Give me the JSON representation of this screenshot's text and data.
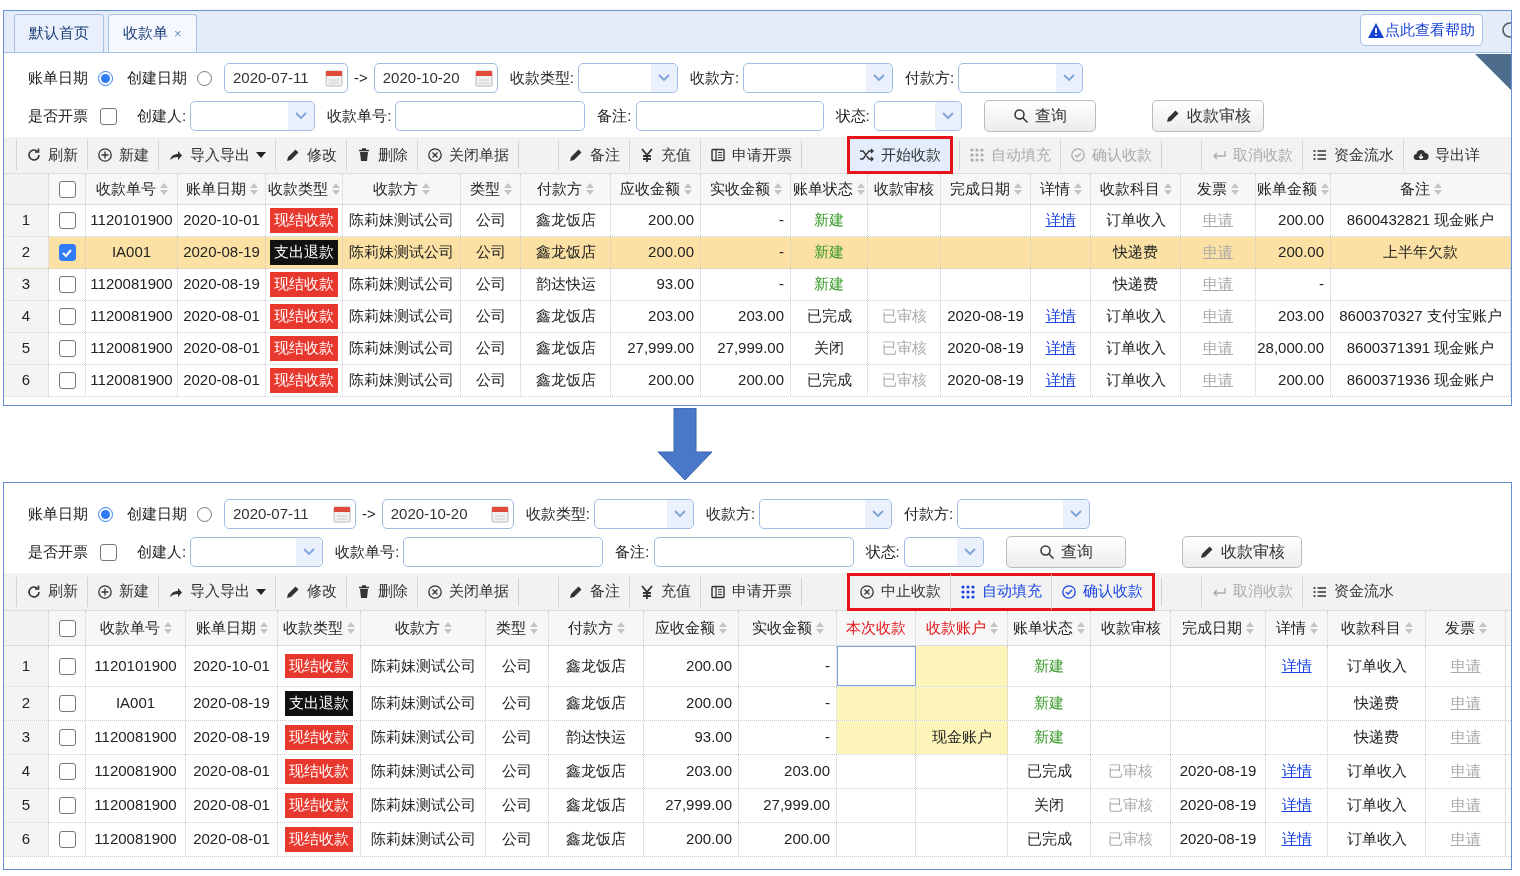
{
  "before": {
    "tab_bar": {
      "tabs": [
        {
          "label": "默认首页",
          "selected": false
        },
        {
          "label": "收款单",
          "selected": true,
          "close": "×"
        }
      ],
      "help": "点此查看帮助"
    },
    "filters": {
      "date_modes": [
        {
          "label": "账单日期",
          "selected": true
        },
        {
          "label": "创建日期",
          "selected": false
        }
      ],
      "date_from": "2020-07-11",
      "range_sep": "->",
      "date_to": "2020-10-20",
      "fields_row1": [
        {
          "label": "收款类型:",
          "kind": "select"
        },
        {
          "label": "收款方:",
          "kind": "select"
        },
        {
          "label": "付款方:",
          "kind": "select"
        }
      ],
      "invoice_filter": {
        "label": "是否开票",
        "checked": false
      },
      "fields_row2": [
        {
          "label": "创建人:",
          "kind": "select"
        },
        {
          "label": "收款单号:",
          "kind": "input"
        },
        {
          "label": "备注:",
          "kind": "input"
        },
        {
          "label": "状态:",
          "kind": "select"
        }
      ],
      "buttons": [
        {
          "label": "查询",
          "kind": "search"
        },
        {
          "label": "收款审核",
          "kind": "pencil"
        }
      ]
    },
    "toolbar": [
      [
        {
          "label": "刷新",
          "kind": "refresh",
          "disabled": false,
          "pressed": false,
          "highlighted": false,
          "callout": false
        },
        {
          "label": "新建",
          "kind": "plus",
          "disabled": false,
          "pressed": false,
          "highlighted": false,
          "callout": false
        },
        {
          "label": "导入导出",
          "kind": "share",
          "disabled": false,
          "pressed": false,
          "highlighted": false,
          "callout": false,
          "dropdown": true
        },
        {
          "label": "修改",
          "kind": "pencil",
          "disabled": false,
          "pressed": false,
          "highlighted": false,
          "callout": false
        },
        {
          "label": "删除",
          "kind": "trash",
          "disabled": false,
          "pressed": false,
          "highlighted": false,
          "callout": false
        },
        {
          "label": "关闭单据",
          "kind": "xcircle",
          "disabled": false,
          "pressed": false,
          "highlighted": false,
          "callout": false
        }
      ],
      [
        {
          "label": "备注",
          "kind": "pencil",
          "disabled": false,
          "pressed": false,
          "highlighted": false,
          "callout": false
        },
        {
          "label": "充值",
          "kind": "yen",
          "disabled": false,
          "pressed": false,
          "highlighted": false,
          "callout": false
        },
        {
          "label": "申请开票",
          "kind": "book",
          "disabled": false,
          "pressed": false,
          "highlighted": false,
          "callout": false
        }
      ],
      [
        {
          "label": "开始收款",
          "kind": "shuffle",
          "disabled": false,
          "pressed": true,
          "highlighted": false,
          "callout": true
        },
        {
          "label": "自动填充",
          "kind": "grid",
          "disabled": true,
          "pressed": false,
          "highlighted": false,
          "callout": false
        },
        {
          "label": "确认收款",
          "kind": "check",
          "disabled": true,
          "pressed": false,
          "highlighted": false,
          "callout": false
        }
      ],
      [
        {
          "label": "取消收款",
          "kind": "return",
          "disabled": true,
          "pressed": false,
          "highlighted": false,
          "callout": false
        },
        {
          "label": "资金流水",
          "kind": "list",
          "disabled": false,
          "pressed": false,
          "highlighted": false,
          "callout": false
        },
        {
          "label": "导出详",
          "kind": "cloud",
          "disabled": false,
          "pressed": false,
          "highlighted": false,
          "callout": false
        }
      ]
    ],
    "table": {
      "select_all_checked": false,
      "columns": [
        {
          "label": "收款单号",
          "kind": "text",
          "sortable": true,
          "emphasis": false
        },
        {
          "label": "账单日期",
          "kind": "text",
          "sortable": true,
          "emphasis": false
        },
        {
          "label": "收款类型",
          "kind": "tag",
          "sortable": true,
          "emphasis": false
        },
        {
          "label": "收款方",
          "kind": "text",
          "sortable": true,
          "emphasis": false
        },
        {
          "label": "类型",
          "kind": "text",
          "sortable": true,
          "emphasis": false
        },
        {
          "label": "付款方",
          "kind": "text",
          "sortable": true,
          "emphasis": false
        },
        {
          "label": "应收金额",
          "kind": "amount",
          "sortable": true,
          "emphasis": false
        },
        {
          "label": "实收金额",
          "kind": "amount",
          "sortable": true,
          "emphasis": false
        },
        {
          "label": "账单状态",
          "kind": "status",
          "sortable": true,
          "emphasis": false
        },
        {
          "label": "收款审核",
          "kind": "muted",
          "sortable": false,
          "emphasis": false
        },
        {
          "label": "完成日期",
          "kind": "text",
          "sortable": true,
          "emphasis": false
        },
        {
          "label": "详情",
          "kind": "link",
          "sortable": true,
          "emphasis": false
        },
        {
          "label": "收款科目",
          "kind": "text",
          "sortable": true,
          "emphasis": false
        },
        {
          "label": "发票",
          "kind": "invoice",
          "sortable": true,
          "emphasis": false
        },
        {
          "label": "账单金额",
          "kind": "amount",
          "sortable": true,
          "emphasis": false
        },
        {
          "label": "备注",
          "kind": "text",
          "sortable": true,
          "emphasis": false
        }
      ],
      "rows": [
        {
          "number": "1",
          "checked": false,
          "selected": false,
          "cells": [
            "1120101900",
            "2020-10-01",
            {
              "text": "现结收款",
              "color": "#e8372c"
            },
            "陈莉妹测试公司",
            "公司",
            "鑫龙饭店",
            "200.00",
            "-",
            {
              "text": "新建",
              "color": "#3a9a2a"
            },
            null,
            null,
            "详情",
            "订单收入",
            "申请",
            "200.00",
            "8600432821 现金账户"
          ]
        },
        {
          "number": "2",
          "checked": true,
          "selected": true,
          "cells": [
            "IA001",
            "2020-08-19",
            {
              "text": "支出退款",
              "color": "#111111"
            },
            "陈莉妹测试公司",
            "公司",
            "鑫龙饭店",
            "200.00",
            "-",
            {
              "text": "新建",
              "color": "#3a9a2a"
            },
            null,
            null,
            null,
            "快递费",
            "申请",
            "200.00",
            "上半年欠款"
          ]
        },
        {
          "number": "3",
          "checked": false,
          "selected": false,
          "cells": [
            "1120081900",
            "2020-08-19",
            {
              "text": "现结收款",
              "color": "#e8372c"
            },
            "陈莉妹测试公司",
            "公司",
            "韵达快运",
            "93.00",
            "-",
            {
              "text": "新建",
              "color": "#3a9a2a"
            },
            null,
            null,
            null,
            "快递费",
            "申请",
            "-",
            null
          ]
        },
        {
          "number": "4",
          "checked": false,
          "selected": false,
          "cells": [
            "1120081900",
            "2020-08-01",
            {
              "text": "现结收款",
              "color": "#e8372c"
            },
            "陈莉妹测试公司",
            "公司",
            "鑫龙饭店",
            "203.00",
            "203.00",
            {
              "text": "已完成",
              "color": "#222222"
            },
            "已审核",
            "2020-08-19",
            "详情",
            "订单收入",
            "申请",
            "203.00",
            "8600370327 支付宝账户"
          ]
        },
        {
          "number": "5",
          "checked": false,
          "selected": false,
          "cells": [
            "1120081900",
            "2020-08-01",
            {
              "text": "现结收款",
              "color": "#e8372c"
            },
            "陈莉妹测试公司",
            "公司",
            "鑫龙饭店",
            "27,999.00",
            "27,999.00",
            {
              "text": "关闭",
              "color": "#222222"
            },
            "已审核",
            "2020-08-19",
            "详情",
            "订单收入",
            "申请",
            "28,000.00",
            "8600371391 现金账户"
          ]
        },
        {
          "number": "6",
          "checked": false,
          "selected": false,
          "cells": [
            "1120081900",
            "2020-08-01",
            {
              "text": "现结收款",
              "color": "#e8372c"
            },
            "陈莉妹测试公司",
            "公司",
            "鑫龙饭店",
            "200.00",
            "200.00",
            {
              "text": "已完成",
              "color": "#222222"
            },
            "已审核",
            "2020-08-19",
            "详情",
            "订单收入",
            "申请",
            "200.00",
            "8600371936 现金账户"
          ]
        }
      ]
    }
  },
  "after": {
    "filters": {
      "date_modes": [
        {
          "label": "账单日期",
          "selected": true
        },
        {
          "label": "创建日期",
          "selected": false
        }
      ],
      "date_from": "2020-07-11",
      "range_sep": "->",
      "date_to": "2020-10-20",
      "fields_row1": [
        {
          "label": "收款类型:",
          "kind": "select"
        },
        {
          "label": "收款方:",
          "kind": "select"
        },
        {
          "label": "付款方:",
          "kind": "select"
        }
      ],
      "invoice_filter": {
        "label": "是否开票",
        "checked": false
      },
      "fields_row2": [
        {
          "label": "创建人:",
          "kind": "select"
        },
        {
          "label": "收款单号:",
          "kind": "input"
        },
        {
          "label": "备注:",
          "kind": "input"
        },
        {
          "label": "状态:",
          "kind": "select"
        }
      ],
      "buttons": [
        {
          "label": "查询",
          "kind": "search"
        },
        {
          "label": "收款审核",
          "kind": "pencil"
        }
      ]
    },
    "toolbar": [
      [
        {
          "label": "刷新",
          "kind": "refresh",
          "disabled": false,
          "pressed": false,
          "highlighted": false,
          "callout": false
        },
        {
          "label": "新建",
          "kind": "plus",
          "disabled": false,
          "pressed": false,
          "highlighted": false,
          "callout": false
        },
        {
          "label": "导入导出",
          "kind": "share",
          "disabled": false,
          "pressed": false,
          "highlighted": false,
          "callout": false,
          "dropdown": true
        },
        {
          "label": "修改",
          "kind": "pencil",
          "disabled": false,
          "pressed": false,
          "highlighted": false,
          "callout": false
        },
        {
          "label": "删除",
          "kind": "trash",
          "disabled": false,
          "pressed": false,
          "highlighted": false,
          "callout": false
        },
        {
          "label": "关闭单据",
          "kind": "xcircle",
          "disabled": false,
          "pressed": false,
          "highlighted": false,
          "callout": false
        }
      ],
      [
        {
          "label": "备注",
          "kind": "pencil",
          "disabled": false,
          "pressed": false,
          "highlighted": false,
          "callout": false
        },
        {
          "label": "充值",
          "kind": "yen",
          "disabled": false,
          "pressed": false,
          "highlighted": false,
          "callout": false
        },
        {
          "label": "申请开票",
          "kind": "book",
          "disabled": false,
          "pressed": false,
          "highlighted": false,
          "callout": false
        }
      ],
      [
        {
          "label": "中止收款",
          "kind": "xcircle",
          "disabled": false,
          "pressed": false,
          "highlighted": false,
          "callout": true
        },
        {
          "label": "自动填充",
          "kind": "grid",
          "disabled": false,
          "pressed": false,
          "highlighted": true,
          "callout": true
        },
        {
          "label": "确认收款",
          "kind": "check",
          "disabled": false,
          "pressed": false,
          "highlighted": true,
          "callout": true
        }
      ],
      [
        {
          "label": "取消收款",
          "kind": "return",
          "disabled": true,
          "pressed": false,
          "highlighted": false,
          "callout": false
        },
        {
          "label": "资金流水",
          "kind": "list",
          "disabled": false,
          "pressed": false,
          "highlighted": false,
          "callout": false
        }
      ]
    ],
    "table": {
      "select_all_checked": false,
      "columns": [
        {
          "label": "收款单号",
          "kind": "text",
          "sortable": true,
          "emphasis": false
        },
        {
          "label": "账单日期",
          "kind": "text",
          "sortable": true,
          "emphasis": false
        },
        {
          "label": "收款类型",
          "kind": "tag",
          "sortable": true,
          "emphasis": false
        },
        {
          "label": "收款方",
          "kind": "text",
          "sortable": true,
          "emphasis": false
        },
        {
          "label": "类型",
          "kind": "text",
          "sortable": true,
          "emphasis": false
        },
        {
          "label": "付款方",
          "kind": "text",
          "sortable": true,
          "emphasis": false
        },
        {
          "label": "应收金额",
          "kind": "amount",
          "sortable": true,
          "emphasis": false
        },
        {
          "label": "实收金额",
          "kind": "amount",
          "sortable": true,
          "emphasis": false
        },
        {
          "label": "本次收款",
          "kind": "entry",
          "sortable": false,
          "emphasis": true
        },
        {
          "label": "收款账户",
          "kind": "entry",
          "sortable": true,
          "emphasis": true
        },
        {
          "label": "账单状态",
          "kind": "status",
          "sortable": true,
          "emphasis": false
        },
        {
          "label": "收款审核",
          "kind": "muted",
          "sortable": false,
          "emphasis": false
        },
        {
          "label": "完成日期",
          "kind": "text",
          "sortable": true,
          "emphasis": false
        },
        {
          "label": "详情",
          "kind": "link",
          "sortable": true,
          "emphasis": false
        },
        {
          "label": "收款科目",
          "kind": "text",
          "sortable": true,
          "emphasis": false
        },
        {
          "label": "发票",
          "kind": "invoice",
          "sortable": true,
          "emphasis": false
        }
      ],
      "rows": [
        {
          "number": "1",
          "checked": false,
          "selected": false,
          "cells": [
            "1120101900",
            "2020-10-01",
            {
              "text": "现结收款",
              "color": "#e8372c"
            },
            "陈莉妹测试公司",
            "公司",
            "鑫龙饭店",
            "200.00",
            "-",
            {
              "editable": true,
              "focused": true
            },
            {
              "editable": true,
              "focused": false
            },
            {
              "text": "新建",
              "color": "#3a9a2a"
            },
            null,
            null,
            "详情",
            "订单收入",
            "申请"
          ]
        },
        {
          "number": "2",
          "checked": false,
          "selected": false,
          "cells": [
            "IA001",
            "2020-08-19",
            {
              "text": "支出退款",
              "color": "#111111"
            },
            "陈莉妹测试公司",
            "公司",
            "鑫龙饭店",
            "200.00",
            "-",
            {
              "editable": true,
              "focused": false
            },
            {
              "editable": true,
              "focused": false
            },
            {
              "text": "新建",
              "color": "#3a9a2a"
            },
            null,
            null,
            null,
            "快递费",
            "申请"
          ]
        },
        {
          "number": "3",
          "checked": false,
          "selected": false,
          "cells": [
            "1120081900",
            "2020-08-19",
            {
              "text": "现结收款",
              "color": "#e8372c"
            },
            "陈莉妹测试公司",
            "公司",
            "韵达快运",
            "93.00",
            "-",
            {
              "editable": true,
              "focused": false
            },
            {
              "editable": true,
              "focused": false,
              "text": "现金账户"
            },
            {
              "text": "新建",
              "color": "#3a9a2a"
            },
            null,
            null,
            null,
            "快递费",
            "申请"
          ]
        },
        {
          "number": "4",
          "checked": false,
          "selected": false,
          "cells": [
            "1120081900",
            "2020-08-01",
            {
              "text": "现结收款",
              "color": "#e8372c"
            },
            "陈莉妹测试公司",
            "公司",
            "鑫龙饭店",
            "203.00",
            "203.00",
            {
              "editable": false,
              "focused": false
            },
            {
              "editable": false,
              "focused": false
            },
            {
              "text": "已完成",
              "color": "#222222"
            },
            "已审核",
            "2020-08-19",
            "详情",
            "订单收入",
            "申请"
          ]
        },
        {
          "number": "5",
          "checked": false,
          "selected": false,
          "cells": [
            "1120081900",
            "2020-08-01",
            {
              "text": "现结收款",
              "color": "#e8372c"
            },
            "陈莉妹测试公司",
            "公司",
            "鑫龙饭店",
            "27,999.00",
            "27,999.00",
            {
              "editable": false,
              "focused": false
            },
            {
              "editable": false,
              "focused": false
            },
            {
              "text": "关闭",
              "color": "#222222"
            },
            "已审核",
            "2020-08-19",
            "详情",
            "订单收入",
            "申请"
          ]
        },
        {
          "number": "6",
          "checked": false,
          "selected": false,
          "cells": [
            "1120081900",
            "2020-08-01",
            {
              "text": "现结收款",
              "color": "#e8372c"
            },
            "陈莉妹测试公司",
            "公司",
            "鑫龙饭店",
            "200.00",
            "200.00",
            {
              "editable": false,
              "focused": false
            },
            {
              "editable": false,
              "focused": false
            },
            {
              "text": "已完成",
              "color": "#222222"
            },
            "已审核",
            "2020-08-19",
            "详情",
            "订单收入",
            "申请"
          ]
        }
      ]
    }
  }
}
